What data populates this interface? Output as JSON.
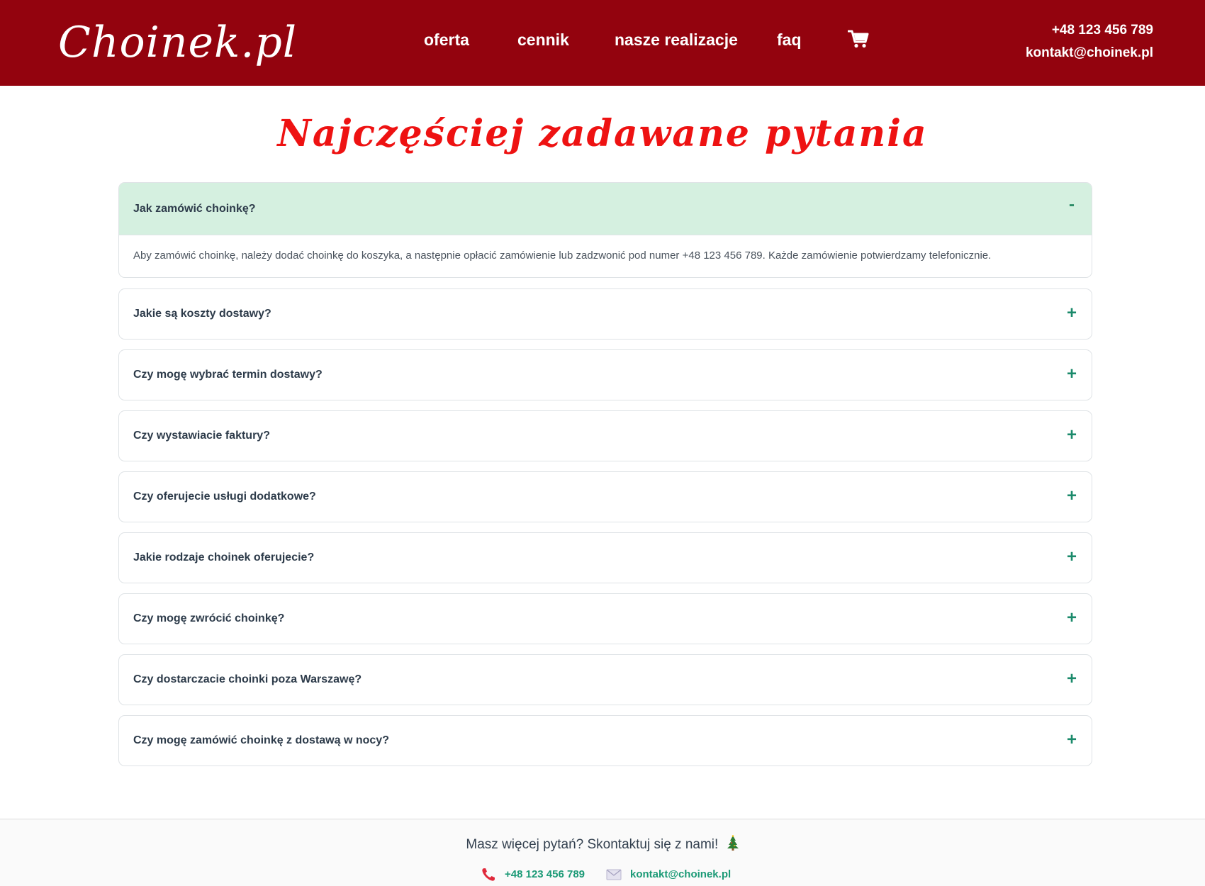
{
  "header": {
    "logo": "Choinek.pl",
    "nav": {
      "offer": "oferta",
      "pricing": "cennik",
      "projects": "nasze realizacje",
      "faq": "faq"
    },
    "cart_icon": "cart-icon",
    "phone": "+48 123 456 789",
    "email": "kontakt@choinek.pl",
    "background": "#93030e"
  },
  "page": {
    "title": "Najczęściej zadawane pytania",
    "title_color": "#ee1212"
  },
  "faq": {
    "items": [
      {
        "question": "Jak zamówić choinkę?",
        "answer": "Aby zamówić choinkę, należy dodać choinkę do koszyka, a następnie opłacić zamówienie lub zadzwonić pod numer +48 123 456 789. Każde zamówienie potwierdzamy telefonicznie.",
        "expanded": true,
        "toggle": "-"
      },
      {
        "question": "Jakie są koszty dostawy?",
        "expanded": false,
        "toggle": "+"
      },
      {
        "question": "Czy mogę wybrać termin dostawy?",
        "expanded": false,
        "toggle": "+"
      },
      {
        "question": "Czy wystawiacie faktury?",
        "expanded": false,
        "toggle": "+"
      },
      {
        "question": "Czy oferujecie usługi dodatkowe?",
        "expanded": false,
        "toggle": "+"
      },
      {
        "question": "Jakie rodzaje choinek oferujecie?",
        "expanded": false,
        "toggle": "+"
      },
      {
        "question": "Czy mogę zwrócić choinkę?",
        "expanded": false,
        "toggle": "+"
      },
      {
        "question": "Czy dostarczacie choinki poza Warszawę?",
        "expanded": false,
        "toggle": "+"
      },
      {
        "question": "Czy mogę zamówić choinkę z dostawą w nocy?",
        "expanded": false,
        "toggle": "+"
      }
    ],
    "expanded_color": "#d5f0e0",
    "toggle_color": "#1b8a6b"
  },
  "footer": {
    "text": "Masz więcej pytań? Skontaktuj się z nami!",
    "tree_icon": "christmas-tree-icon",
    "phone_icon": "phone-icon",
    "phone": "+48 123 456 789",
    "mail_icon": "envelope-icon",
    "email": "kontakt@choinek.pl",
    "link_color": "#1b9a76"
  }
}
